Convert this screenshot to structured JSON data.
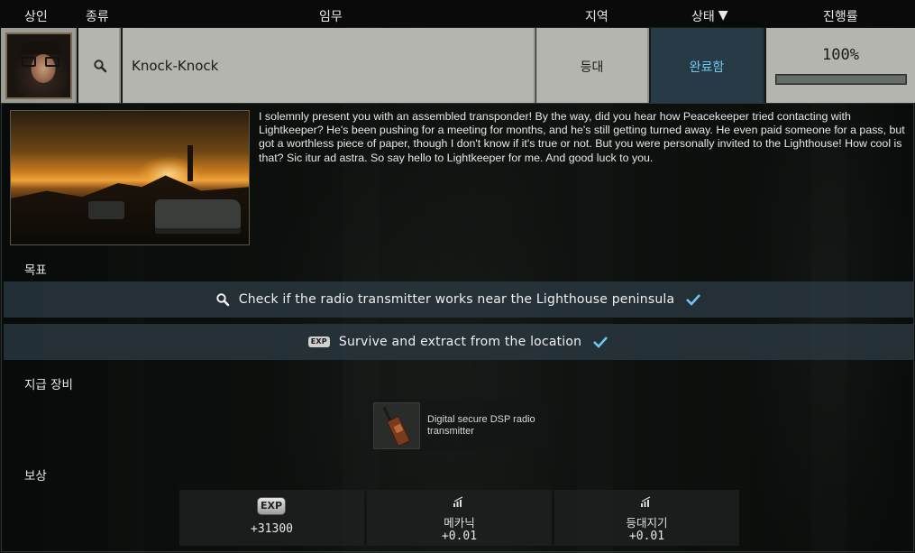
{
  "header": {
    "trader": "상인",
    "type": "종류",
    "task": "임무",
    "location": "지역",
    "status": "상태",
    "progress": "진행률"
  },
  "quest": {
    "name": "Knock-Knock",
    "location": "등대",
    "status": "완료함",
    "progress_label": "100%",
    "progress_value": 1.0,
    "type_icon": "search-icon",
    "trader_icon": "trader-portrait"
  },
  "description": "I solemnly present you with an assembled transponder! By the way, did you hear how Peacekeeper tried contacting with Lightkeeper? He's been pushing for a meeting for months, and he's still getting turned away. He even paid someone for a pass, but got a worthless piece of paper, though I don't know if it's true or not. But you were personally invited to the Lighthouse! How cool is that? Sic itur ad astra. So say hello to Lightkeeper for me. And good luck to you.",
  "objectives": {
    "title": "목표",
    "items": [
      {
        "icon": "search-icon",
        "text": "Check if the radio transmitter works near the Lighthouse peninsula",
        "done": true
      },
      {
        "icon": "exp-icon",
        "icon_text": "EXP",
        "text": "Survive and extract from the location",
        "done": true
      }
    ]
  },
  "equipment": {
    "title": "지급 장비",
    "items": [
      {
        "name_line1": "Digital secure DSP radio",
        "name_line2": "transmitter"
      }
    ]
  },
  "rewards": {
    "title": "보상",
    "items": [
      {
        "icon": "exp-icon",
        "icon_text": "EXP",
        "label": "",
        "value": "+31300"
      },
      {
        "icon": "skill-icon",
        "label": "메카닉",
        "value": "+0.01"
      },
      {
        "icon": "skill-icon",
        "label": "등대지기",
        "value": "+0.01"
      }
    ]
  },
  "colors": {
    "status_text": "#6dc8ef",
    "check": "#6dc8ef",
    "objective_bg": "#2c3a42"
  }
}
